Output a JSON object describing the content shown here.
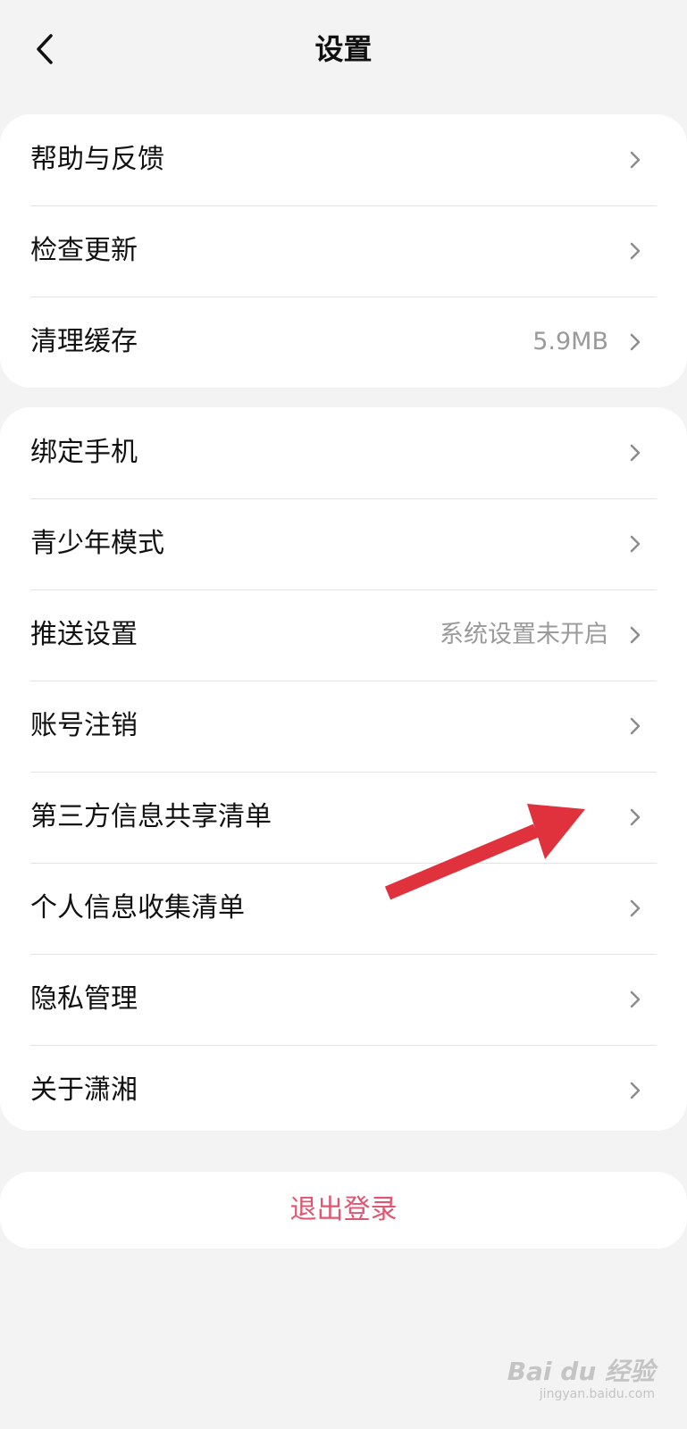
{
  "header": {
    "title": "设置",
    "back_icon": "chevron-left-icon"
  },
  "group1": {
    "items": [
      {
        "label": "帮助与反馈",
        "value": ""
      },
      {
        "label": "检查更新",
        "value": ""
      },
      {
        "label": "清理缓存",
        "value": "5.9MB"
      }
    ]
  },
  "group2": {
    "items": [
      {
        "label": "绑定手机",
        "value": ""
      },
      {
        "label": "青少年模式",
        "value": ""
      },
      {
        "label": "推送设置",
        "value": "系统设置未开启"
      },
      {
        "label": "账号注销",
        "value": ""
      },
      {
        "label": "第三方信息共享清单",
        "value": ""
      },
      {
        "label": "个人信息收集清单",
        "value": ""
      },
      {
        "label": "隐私管理",
        "value": ""
      },
      {
        "label": "关于潇湘",
        "value": ""
      }
    ]
  },
  "logout": {
    "label": "退出登录"
  },
  "annotation": {
    "type": "red-arrow",
    "color": "#e0323c"
  },
  "watermark": {
    "main": "Bai du 经验",
    "sub": "jingyan.baidu.com"
  },
  "colors": {
    "background": "#f3f3f3",
    "card": "#ffffff",
    "secondary_text": "#9a9a9a",
    "logout_text": "#e05570"
  }
}
